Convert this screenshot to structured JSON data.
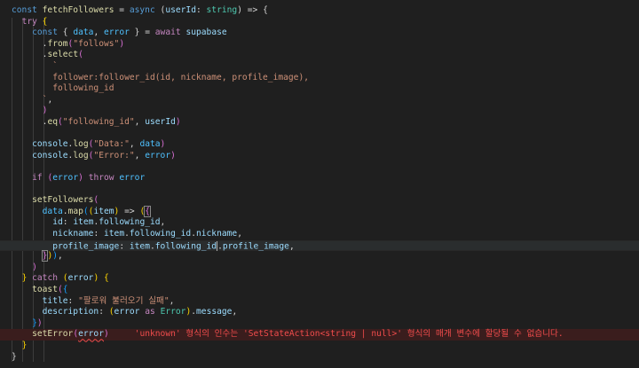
{
  "editor": {
    "lines": [
      [
        {
          "t": "const ",
          "c": "kw"
        },
        {
          "t": "fetchFollowers",
          "c": "fn"
        },
        {
          "t": " = ",
          "c": "p"
        },
        {
          "t": "async",
          "c": "kw"
        },
        {
          "t": " (",
          "c": "p"
        },
        {
          "t": "userId",
          "c": "var"
        },
        {
          "t": ": ",
          "c": "p"
        },
        {
          "t": "string",
          "c": "typ"
        },
        {
          "t": ") => {",
          "c": "p"
        }
      ],
      [
        {
          "t": "  "
        },
        {
          "t": "try",
          "c": "ctl"
        },
        {
          "t": " {",
          "c": "br1"
        }
      ],
      [
        {
          "t": "    "
        },
        {
          "t": "const",
          "c": "kw"
        },
        {
          "t": " { ",
          "c": "p"
        },
        {
          "t": "data",
          "c": "cst"
        },
        {
          "t": ", ",
          "c": "p"
        },
        {
          "t": "error",
          "c": "cst"
        },
        {
          "t": " } = ",
          "c": "p"
        },
        {
          "t": "await",
          "c": "ctl"
        },
        {
          "t": " ",
          "c": "p"
        },
        {
          "t": "supabase",
          "c": "var"
        }
      ],
      [
        {
          "t": "      ."
        },
        {
          "t": "from",
          "c": "fn"
        },
        {
          "t": "(",
          "c": "br2"
        },
        {
          "t": "\"follows\"",
          "c": "str"
        },
        {
          "t": ")",
          "c": "br2"
        }
      ],
      [
        {
          "t": "      ."
        },
        {
          "t": "select",
          "c": "fn"
        },
        {
          "t": "(",
          "c": "br2"
        }
      ],
      [
        {
          "t": "        "
        },
        {
          "t": "`",
          "c": "str"
        }
      ],
      [
        {
          "t": "        "
        },
        {
          "t": "follower:follower_id(id, nickname, profile_image),",
          "c": "str"
        }
      ],
      [
        {
          "t": "        "
        },
        {
          "t": "following_id",
          "c": "str"
        }
      ],
      [
        {
          "t": "      "
        },
        {
          "t": "`",
          "c": "str"
        },
        {
          "t": ",",
          "c": "p"
        }
      ],
      [
        {
          "t": "      "
        },
        {
          "t": ")",
          "c": "br2"
        }
      ],
      [
        {
          "t": "      ."
        },
        {
          "t": "eq",
          "c": "fn"
        },
        {
          "t": "(",
          "c": "br2"
        },
        {
          "t": "\"following_id\"",
          "c": "str"
        },
        {
          "t": ", ",
          "c": "p"
        },
        {
          "t": "userId",
          "c": "var"
        },
        {
          "t": ")",
          "c": "br2"
        }
      ],
      [],
      [
        {
          "t": "    "
        },
        {
          "t": "console",
          "c": "var"
        },
        {
          "t": "."
        },
        {
          "t": "log",
          "c": "fn"
        },
        {
          "t": "(",
          "c": "br2"
        },
        {
          "t": "\"Data:\"",
          "c": "str"
        },
        {
          "t": ", "
        },
        {
          "t": "data",
          "c": "cst"
        },
        {
          "t": ")",
          "c": "br2"
        }
      ],
      [
        {
          "t": "    "
        },
        {
          "t": "console",
          "c": "var"
        },
        {
          "t": "."
        },
        {
          "t": "log",
          "c": "fn"
        },
        {
          "t": "(",
          "c": "br2"
        },
        {
          "t": "\"Error:\"",
          "c": "str"
        },
        {
          "t": ", "
        },
        {
          "t": "error",
          "c": "cst"
        },
        {
          "t": ")",
          "c": "br2"
        }
      ],
      [],
      [
        {
          "t": "    "
        },
        {
          "t": "if",
          "c": "ctl"
        },
        {
          "t": " "
        },
        {
          "t": "(",
          "c": "br2"
        },
        {
          "t": "error",
          "c": "cst"
        },
        {
          "t": ")",
          "c": "br2"
        },
        {
          "t": " "
        },
        {
          "t": "throw",
          "c": "ctl"
        },
        {
          "t": " "
        },
        {
          "t": "error",
          "c": "cst"
        }
      ],
      [],
      [
        {
          "t": "    "
        },
        {
          "t": "setFollowers",
          "c": "fn"
        },
        {
          "t": "(",
          "c": "br2"
        }
      ],
      [
        {
          "t": "      "
        },
        {
          "t": "data",
          "c": "cst"
        },
        {
          "t": "."
        },
        {
          "t": "map",
          "c": "fn"
        },
        {
          "t": "(",
          "c": "br3"
        },
        {
          "t": "(",
          "c": "br1"
        },
        {
          "t": "item",
          "c": "var"
        },
        {
          "t": ")",
          "c": "br1"
        },
        {
          "t": " => "
        },
        {
          "t": "(",
          "c": "br1"
        },
        {
          "t": "{",
          "c": "br2",
          "box": true
        }
      ],
      [
        {
          "t": "        "
        },
        {
          "t": "id",
          "c": "var"
        },
        {
          "t": ": "
        },
        {
          "t": "item",
          "c": "var"
        },
        {
          "t": "."
        },
        {
          "t": "following_id",
          "c": "var"
        },
        {
          "t": ","
        }
      ],
      [
        {
          "t": "        "
        },
        {
          "t": "nickname",
          "c": "var"
        },
        {
          "t": ": "
        },
        {
          "t": "item",
          "c": "var"
        },
        {
          "t": "."
        },
        {
          "t": "following_id",
          "c": "var"
        },
        {
          "t": "."
        },
        {
          "t": "nickname",
          "c": "var"
        },
        {
          "t": ","
        }
      ],
      [
        {
          "t": "        "
        },
        {
          "t": "profile_image",
          "c": "var"
        },
        {
          "t": ": "
        },
        {
          "t": "item",
          "c": "var"
        },
        {
          "t": "."
        },
        {
          "t": "following_id",
          "c": "var"
        },
        {
          "cursor": true
        },
        {
          "t": "."
        },
        {
          "t": "profile_image",
          "c": "var"
        },
        {
          "t": ","
        }
      ],
      [
        {
          "t": "      "
        },
        {
          "t": "}",
          "c": "br2",
          "box": true
        },
        {
          "t": ")",
          "c": "br1"
        },
        {
          "t": ")",
          "c": "br3"
        },
        {
          "t": ","
        }
      ],
      [
        {
          "t": "    "
        },
        {
          "t": ")",
          "c": "br2"
        }
      ],
      [
        {
          "t": "  "
        },
        {
          "t": "}",
          "c": "br1"
        },
        {
          "t": " "
        },
        {
          "t": "catch",
          "c": "ctl"
        },
        {
          "t": " "
        },
        {
          "t": "(",
          "c": "br1"
        },
        {
          "t": "error",
          "c": "var"
        },
        {
          "t": ")",
          "c": "br1"
        },
        {
          "t": " "
        },
        {
          "t": "{",
          "c": "br1"
        }
      ],
      [
        {
          "t": "    "
        },
        {
          "t": "toast",
          "c": "fn"
        },
        {
          "t": "(",
          "c": "br2"
        },
        {
          "t": "{",
          "c": "br3"
        }
      ],
      [
        {
          "t": "      "
        },
        {
          "t": "title",
          "c": "var"
        },
        {
          "t": ": "
        },
        {
          "t": "\"팔로워 불러오기 실패\"",
          "c": "str"
        },
        {
          "t": ","
        }
      ],
      [
        {
          "t": "      "
        },
        {
          "t": "description",
          "c": "var"
        },
        {
          "t": ": "
        },
        {
          "t": "(",
          "c": "br1"
        },
        {
          "t": "error",
          "c": "var"
        },
        {
          "t": " "
        },
        {
          "t": "as",
          "c": "ctl"
        },
        {
          "t": " "
        },
        {
          "t": "Error",
          "c": "typ"
        },
        {
          "t": ")",
          "c": "br1"
        },
        {
          "t": "."
        },
        {
          "t": "message",
          "c": "var"
        },
        {
          "t": ","
        }
      ],
      [
        {
          "t": "    "
        },
        {
          "t": "}",
          "c": "br3"
        },
        {
          "t": ")",
          "c": "br2"
        }
      ],
      [
        {
          "t": "    "
        },
        {
          "t": "setError",
          "c": "fn"
        },
        {
          "t": "(",
          "c": "br2"
        },
        {
          "t": "error",
          "c": "var",
          "squiggle": true
        },
        {
          "t": ")",
          "c": "br2"
        },
        {
          "t": "     "
        },
        {
          "t": "'unknown' 형식의 인수는 'SetStateAction<string | null>' 형식의 매개 변수에 할당될 수 없습니다.",
          "c": "err-msg"
        }
      ],
      [
        {
          "t": "  "
        },
        {
          "t": "}",
          "c": "br1"
        }
      ],
      [
        {
          "t": "}",
          "c": "p"
        }
      ]
    ]
  }
}
